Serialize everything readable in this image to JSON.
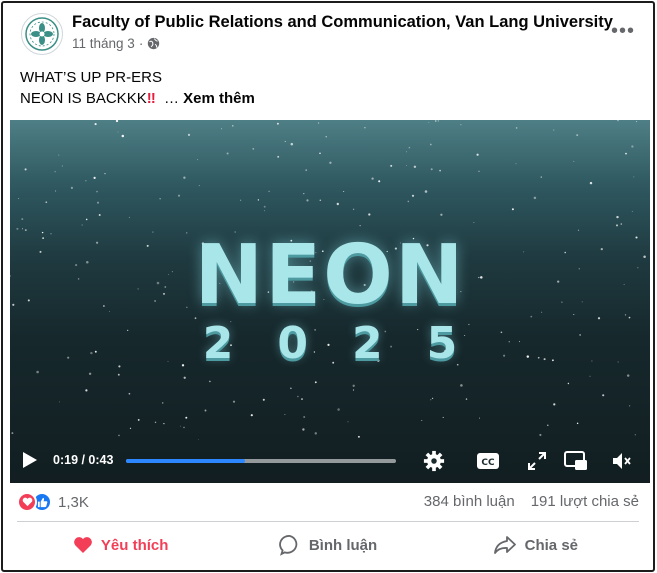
{
  "post": {
    "page_name": "Faculty of Public Relations and Communication, Van Lang University",
    "date": "11 tháng 3",
    "separator": "·",
    "text_line1": "WHAT’S UP PR-ERS",
    "text_line2": "NEON IS BACKKK",
    "emoji": "‼",
    "see_more_prefix": "…",
    "see_more": "Xem thêm"
  },
  "video": {
    "title": "NEON",
    "subtitle": "2025",
    "time": "0:19 / 0:43",
    "progress": 0.44
  },
  "stats": {
    "reaction_count": "1,3K",
    "comments": "384 bình luận",
    "shares": "191 lượt chia sẻ"
  },
  "actions": {
    "like": "Yêu thích",
    "comment": "Bình luận",
    "share": "Chia sẻ"
  },
  "colors": {
    "accent": "#2d88ff",
    "love": "#f33e58",
    "neon": "#a9e6ea"
  },
  "icons": [
    "globe-icon",
    "more-icon",
    "play-icon",
    "settings-icon",
    "cc-icon",
    "fullscreen-icon",
    "pip-icon",
    "mute-icon",
    "love-reaction-icon",
    "like-reaction-icon",
    "comment-icon",
    "share-icon"
  ]
}
